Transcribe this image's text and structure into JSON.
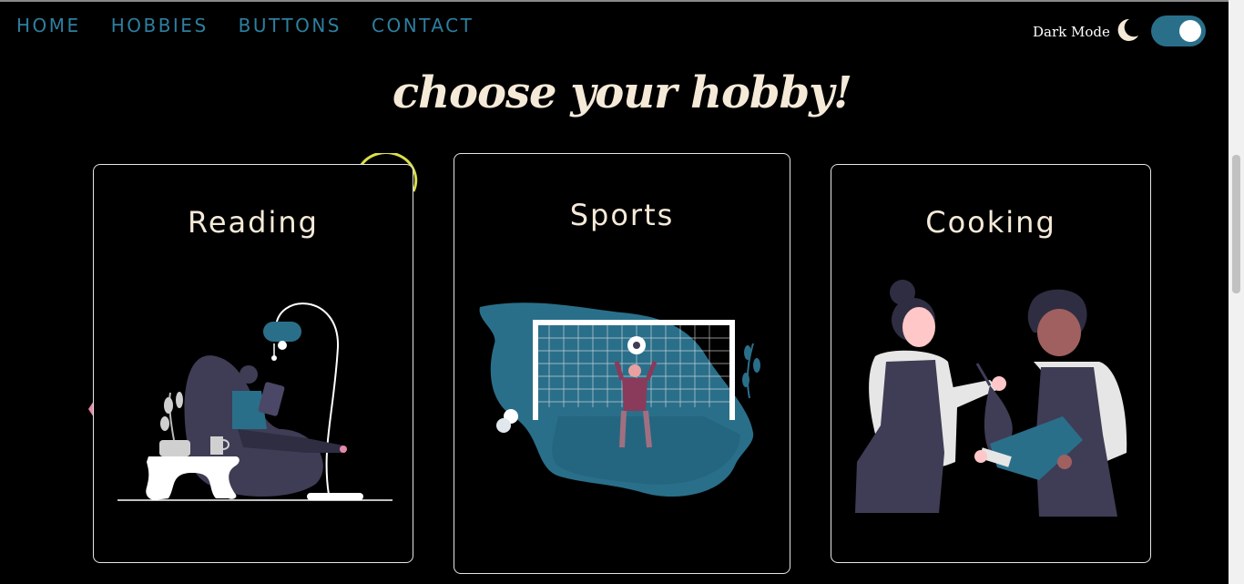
{
  "nav": {
    "items": [
      {
        "label": "HOME"
      },
      {
        "label": "HOBBIES"
      },
      {
        "label": "BUTTONS"
      },
      {
        "label": "CONTACT"
      }
    ]
  },
  "theme": {
    "dark_mode_label": "Dark Mode",
    "dark_mode_on": true,
    "accent": "#2a6f8a",
    "nav_color": "#2d7fa0",
    "text_color": "#f5ead8"
  },
  "hero": {
    "title": "choose your hobby!"
  },
  "cards": [
    {
      "title": "Reading",
      "illustration": "woman-reading-in-beanbag"
    },
    {
      "title": "Sports",
      "illustration": "goalkeeper-in-goal"
    },
    {
      "title": "Cooking",
      "illustration": "two-chefs-with-recipe"
    }
  ]
}
